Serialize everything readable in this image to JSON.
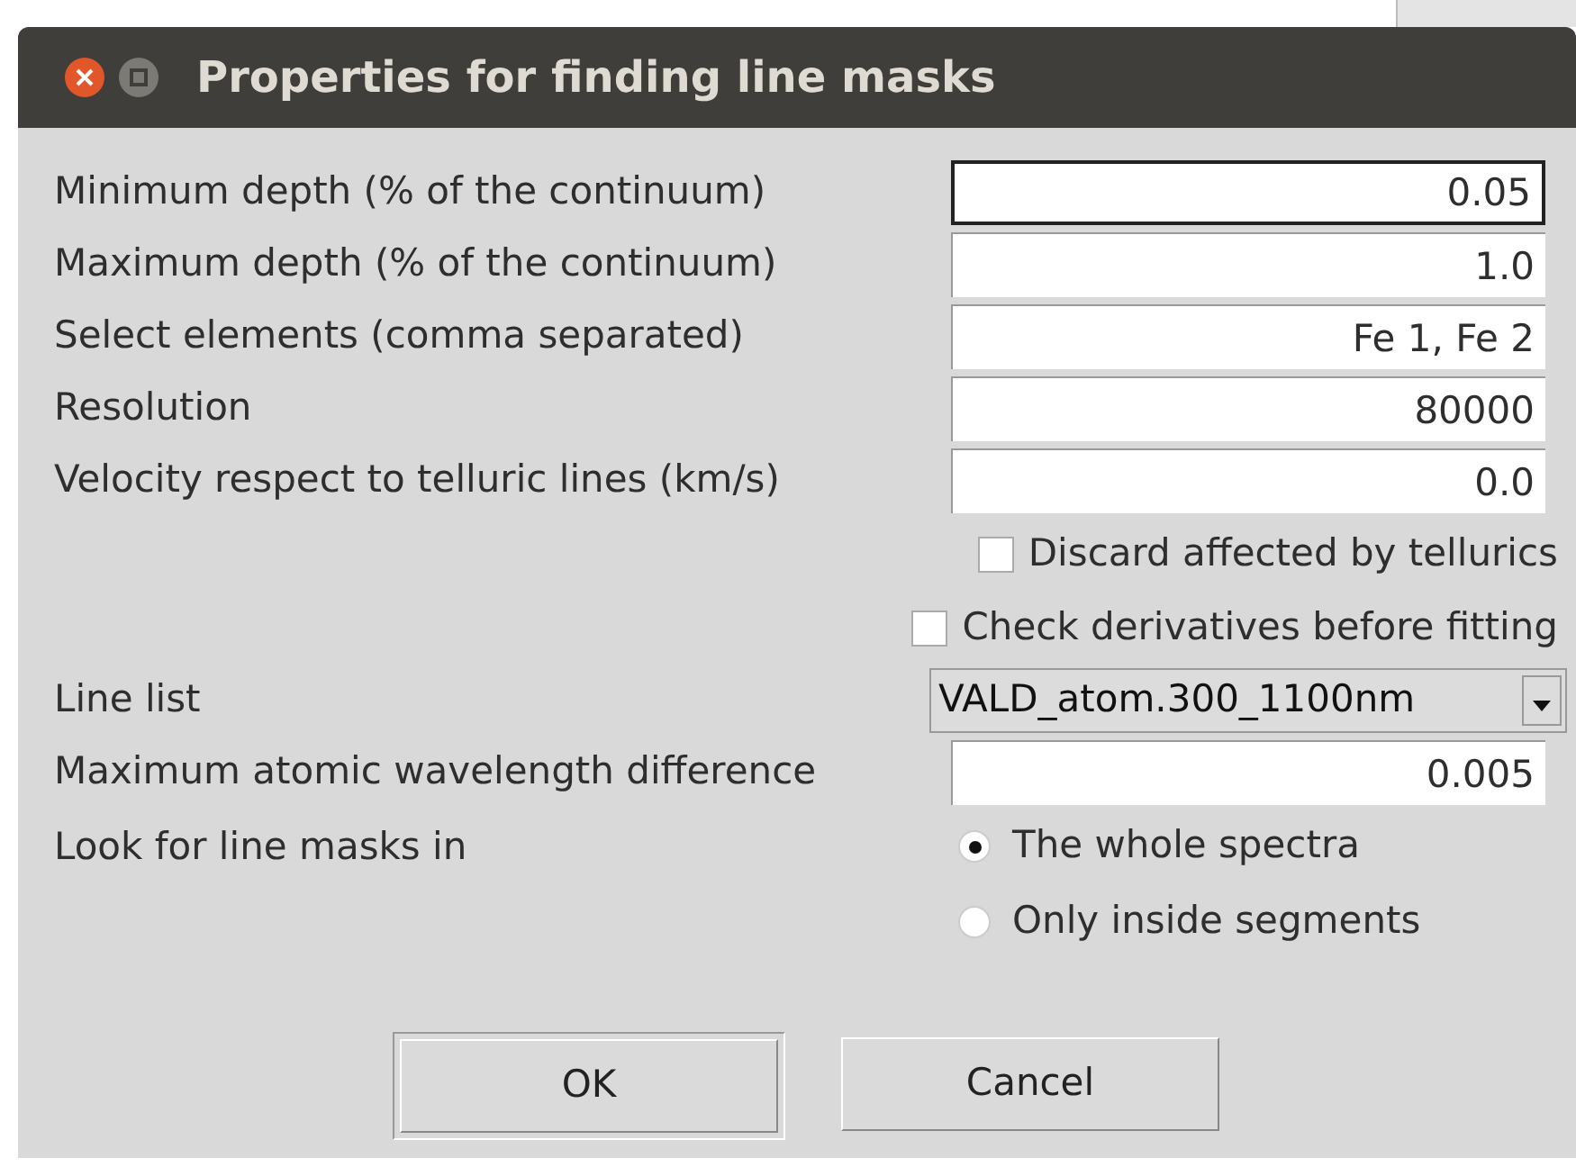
{
  "window": {
    "title": "Properties for finding line masks"
  },
  "rows": [
    {
      "kind": "text",
      "label": "Minimum depth (% of the continuum)",
      "value": "0.05",
      "focused": true
    },
    {
      "kind": "text",
      "label": "Maximum depth (% of the continuum)",
      "value": "1.0",
      "focused": false
    },
    {
      "kind": "text",
      "label": "Select elements (comma separated)",
      "value": "Fe 1, Fe 2",
      "focused": false
    },
    {
      "kind": "text",
      "label": "Resolution",
      "value": "80000",
      "focused": false
    },
    {
      "kind": "text",
      "label": "Velocity respect to telluric lines (km/s)",
      "value": "0.0",
      "focused": false
    },
    {
      "kind": "checkbox",
      "label": "Discard affected by tellurics",
      "checked": false
    },
    {
      "kind": "checkbox",
      "label": "Check derivatives before fitting",
      "checked": false
    },
    {
      "kind": "dropdown",
      "label": "Line list",
      "value": "VALD_atom.300_1100nm"
    },
    {
      "kind": "text",
      "label": "Maximum atomic wavelength difference",
      "value": "0.005",
      "focused": false
    },
    {
      "kind": "radio",
      "label": "Look for line masks in",
      "options": [
        {
          "label": "The whole spectra",
          "selected": true
        },
        {
          "label": "Only inside segments",
          "selected": false
        }
      ]
    }
  ],
  "buttons": [
    {
      "label": "OK",
      "default": true
    },
    {
      "label": "Cancel",
      "default": false
    }
  ]
}
